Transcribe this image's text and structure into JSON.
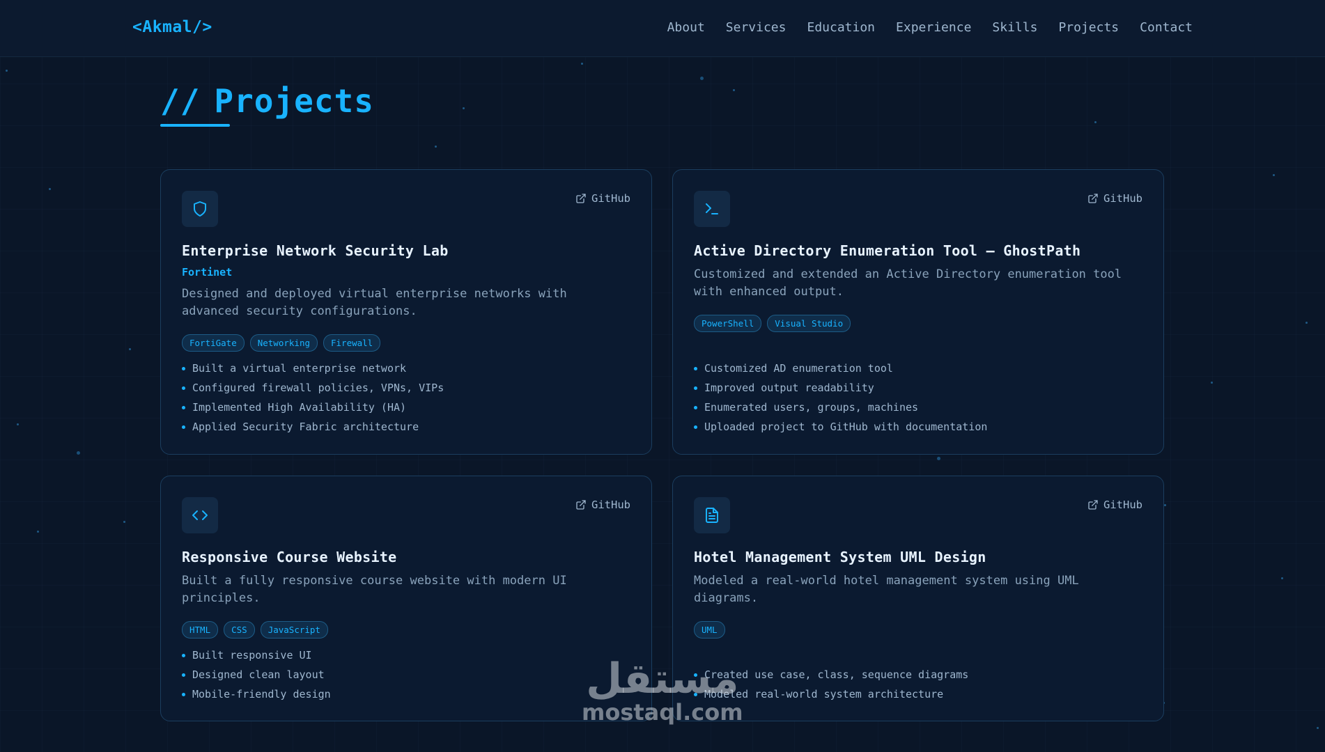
{
  "nav": {
    "logo": "<Akmal/>",
    "items": [
      "About",
      "Services",
      "Education",
      "Experience",
      "Skills",
      "Projects",
      "Contact"
    ]
  },
  "section": {
    "prefix": "//",
    "title": "Projects"
  },
  "projects": [
    {
      "icon": "shield-icon",
      "link": "GitHub",
      "title": "Enterprise Network Security Lab",
      "subtitle": "Fortinet",
      "description": "Designed and deployed virtual enterprise networks with advanced security configurations.",
      "tags": [
        "FortiGate",
        "Networking",
        "Firewall"
      ],
      "bullets": [
        "Built a virtual enterprise network",
        "Configured firewall policies, VPNs, VIPs",
        "Implemented High Availability (HA)",
        "Applied Security Fabric architecture"
      ]
    },
    {
      "icon": "terminal-icon",
      "link": "GitHub",
      "title": "Active Directory Enumeration Tool — GhostPath",
      "description": "Customized and extended an Active Directory enumeration tool with enhanced output.",
      "tags": [
        "PowerShell",
        "Visual Studio"
      ],
      "bullets": [
        "Customized AD enumeration tool",
        "Improved output readability",
        "Enumerated users, groups, machines",
        "Uploaded project to GitHub with documentation"
      ]
    },
    {
      "icon": "code-icon",
      "link": "GitHub",
      "title": "Responsive Course Website",
      "description": "Built a fully responsive course website with modern UI principles.",
      "tags": [
        "HTML",
        "CSS",
        "JavaScript"
      ],
      "bullets": [
        "Built responsive UI",
        "Designed clean layout",
        "Mobile-friendly design"
      ]
    },
    {
      "icon": "document-icon",
      "link": "GitHub",
      "title": "Hotel Management System UML Design",
      "description": "Modeled a real-world hotel management system using UML diagrams.",
      "tags": [
        "UML"
      ],
      "bullets": [
        "Created use case, class, sequence diagrams",
        "Modeled real-world system architecture"
      ]
    }
  ],
  "watermark": {
    "arabic": "مستقل",
    "latin": "mostaql.com"
  },
  "colors": {
    "background": "#0a1628",
    "accent": "#19b3ff",
    "card": "#0b1a30",
    "card_border": "#1b3e5f"
  }
}
